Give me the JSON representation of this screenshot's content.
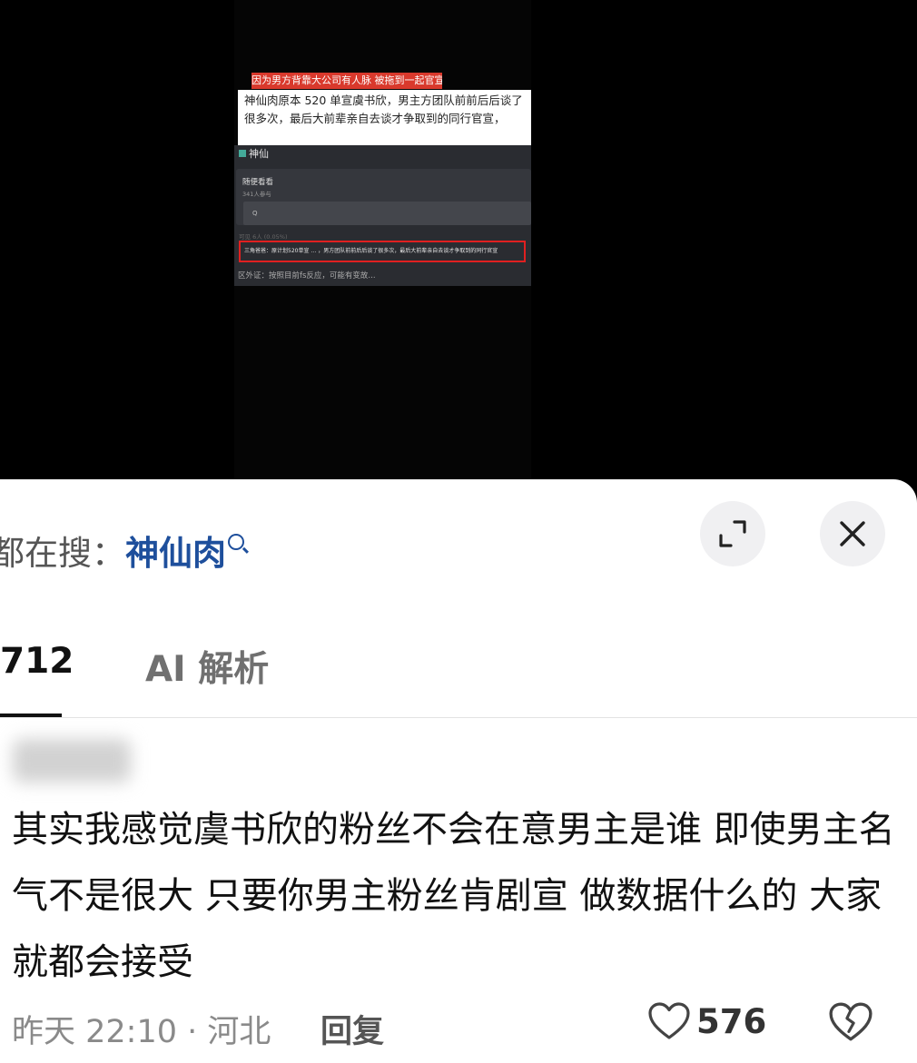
{
  "video": {
    "banner": "因为男方背靠大公司有人脉 被拖到一起官宣",
    "caption": "神仙肉原本 520 单宣虞书欣，男主方团队前前后后谈了很多次，最后大前辈亲自去谈才争取到的同行官宣，",
    "panel_header": "神仙",
    "card_title": "随便看看",
    "card_sub": "341人参与",
    "card_input": "Q",
    "card_meta": "可见 6人 (0.05%)",
    "highlight_text": "三角爸爸：原计划520单宣 … ，男方团队前前后后谈了很多次，最后大前辈亲自去谈才争取到的同行官宣",
    "footer": "区外证：按照目前fs反应，可能有变故..."
  },
  "sheet": {
    "search_prefix": "都在搜：",
    "search_term": "神仙肉",
    "expand_icon": "expand-icon",
    "close_icon": "close-icon",
    "tabs": [
      {
        "label": "712"
      },
      {
        "label": "AI 解析"
      }
    ],
    "comment": {
      "text": "其实我感觉虞书欣的粉丝不会在意男主是谁 即使男主名气不是很大 只要你男主粉丝肯剧宣 做数据什么的 大家就都会接受",
      "time_location": "昨天 22:10 · 河北",
      "reply_label": "回复",
      "likes": "576"
    }
  }
}
